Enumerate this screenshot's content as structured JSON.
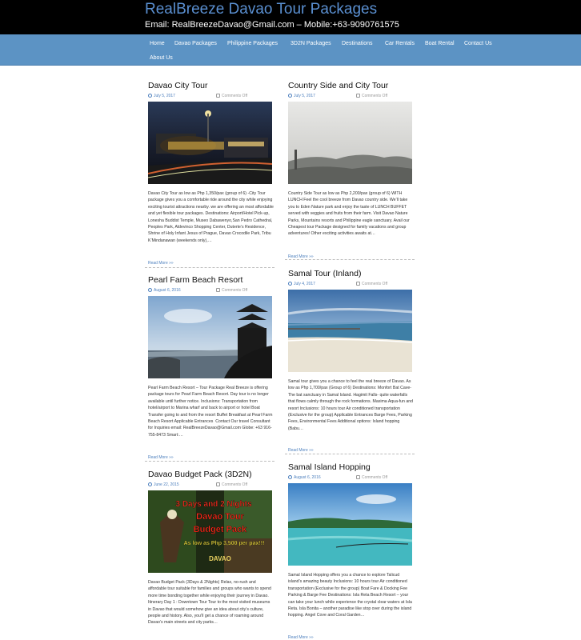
{
  "site": {
    "title": "RealBreeze Davao Tour Packages",
    "contact": "Email: RealBreezeDavao@Gmail.com – Mobile:+63-9090761575"
  },
  "nav": [
    "Home",
    "Davao Packages",
    "Philippine Packages",
    "3D2N Packages",
    "Destinations",
    "Car Rentals",
    "Boat Rental",
    "Contact Us",
    "About Us"
  ],
  "posts": [
    {
      "title": "Davao City Tour",
      "date": "July 5, 2017",
      "comments": "Comments Off",
      "excerpt": "Davao City Tour as low as Php 1,350/pax (group of 6) -City Tour package gives you a comfortable ride around the city while enjoying exciting tourist attractions nearby. we are offering an most affordable and yet flexible tour packages. Destinations: Airport/Hotel Pick-up, Lonesha Buddist Temple, Museo Dabawenyo,San Pedro Cathedral, Peoples Park, Aldevinco Shopping Center, Duterte’s Residence, Shrine of Holy Infant Jesus of Prague, Davao Crocodile Park, Tribu K’Mindanawan (weekends only),…",
      "more": "Read More »»"
    },
    {
      "title": "Country Side and City Tour",
      "date": "July 5, 2017",
      "comments": "Comments Off",
      "excerpt": "Country Side Tour as low as Php 2,200/pax (group of 6) WITH LUNCH Feel the cool breeze from Davao country side. We’ll take you to Eden Nature park and enjoy the taste of LUNCH BUFFET served with veggies and fruits from their farm. Visit Davao Nature Parks, Mountains resorts and Philippine eagle sanctuary. Avail our Cheapest tour Package designed for family vacations and group adventures! Other exciting activities awaits at…",
      "more": "Read More »»"
    },
    {
      "title": "Pearl Farm Beach Resort",
      "date": "August 6, 2016",
      "comments": "Comments Off",
      "excerpt": "Pearl Farm Beach Resort – Tour Package Real Breeze is offering package tours for Pearl Farm Beach Resort. Day tour is no longer available until further notice. Inclusions: Transportation from hotel/airport to Marina wharf and back to airport or hotel Boat Transfer going to and from the resort Buffet Breakfast at Pearl Farm Beach Resort Applicable Entrances  Contact Our travel Consultant for Inquiries email: RealBreezeDavao@Gmail.com Globe: +63 916-755-8473 Smart:…",
      "more": "Read More »»"
    },
    {
      "title": "Samal Tour (Inland)",
      "date": "July 4, 2017",
      "comments": "Comments Off",
      "excerpt": "Samal tour gives you a chance to feel the real breeze of Davao. As low as Php 1,700/pax (Group of 6) Destinations: Monfort Bat Cave- The bat sanctuary in Samal Island. Hagimit Falls- quite waterfalls that flows calmly through the rock formations. Maxima Aqua-fun and resort Inclusions: 10 hours tour Air conditioned transportation (Exclusive for the group) Applicable Entrances Barge Fees, Parking Fees, Environmental Fees Additional options: Island hopping (Babu…",
      "more": "Read More »»"
    },
    {
      "title": "Davao Budget Pack (3D2N)",
      "date": "June 22, 2015",
      "comments": "Comments Off",
      "excerpt": "Davao Budget Pack (3Days & 2Nights) Relax, no-rush and affordable tour suitable for families and groups who wants to spend more time bonding together while enjoying their journey in Davao. Itinerary Day 1 : Downtown Tour Tour to the most visited museums in Davao that would somehow give an idea about city’s culture, people and history. Also, you’ll get a chance of roaming around Davao’s main streets and city parks…",
      "more": "Read More »»",
      "image_text": [
        "3 Days and 2 Nights",
        "Davao Tour",
        "Budget Pack",
        "As low as Php 3,500 per pax!!!",
        "DAVAO"
      ]
    },
    {
      "title": "Samal Island Hopping",
      "date": "August 6, 2016",
      "comments": "Comments Off",
      "excerpt": "Samal Island Hopping offers you a chance to explore Talicud island’s amazing beauty Inclusions: 10 hours tour Air conditioned transportation (Exclusive for the group) Boat Fare & Docking Fee Parking & Barge Fee Destinations: Isla Reta Beach Resort – your can take your lunch while experience the crystal clear waters at Isla Reta. Isla Bonita – another paradise like stop over during the island hopping. Angel Cove and Coral Garden…",
      "more": "Read More »»"
    }
  ],
  "colors": {
    "header_bg": "#000000",
    "title": "#5a8fd0",
    "nav_bg": "#5c93c4",
    "link": "#4c7fbd"
  }
}
